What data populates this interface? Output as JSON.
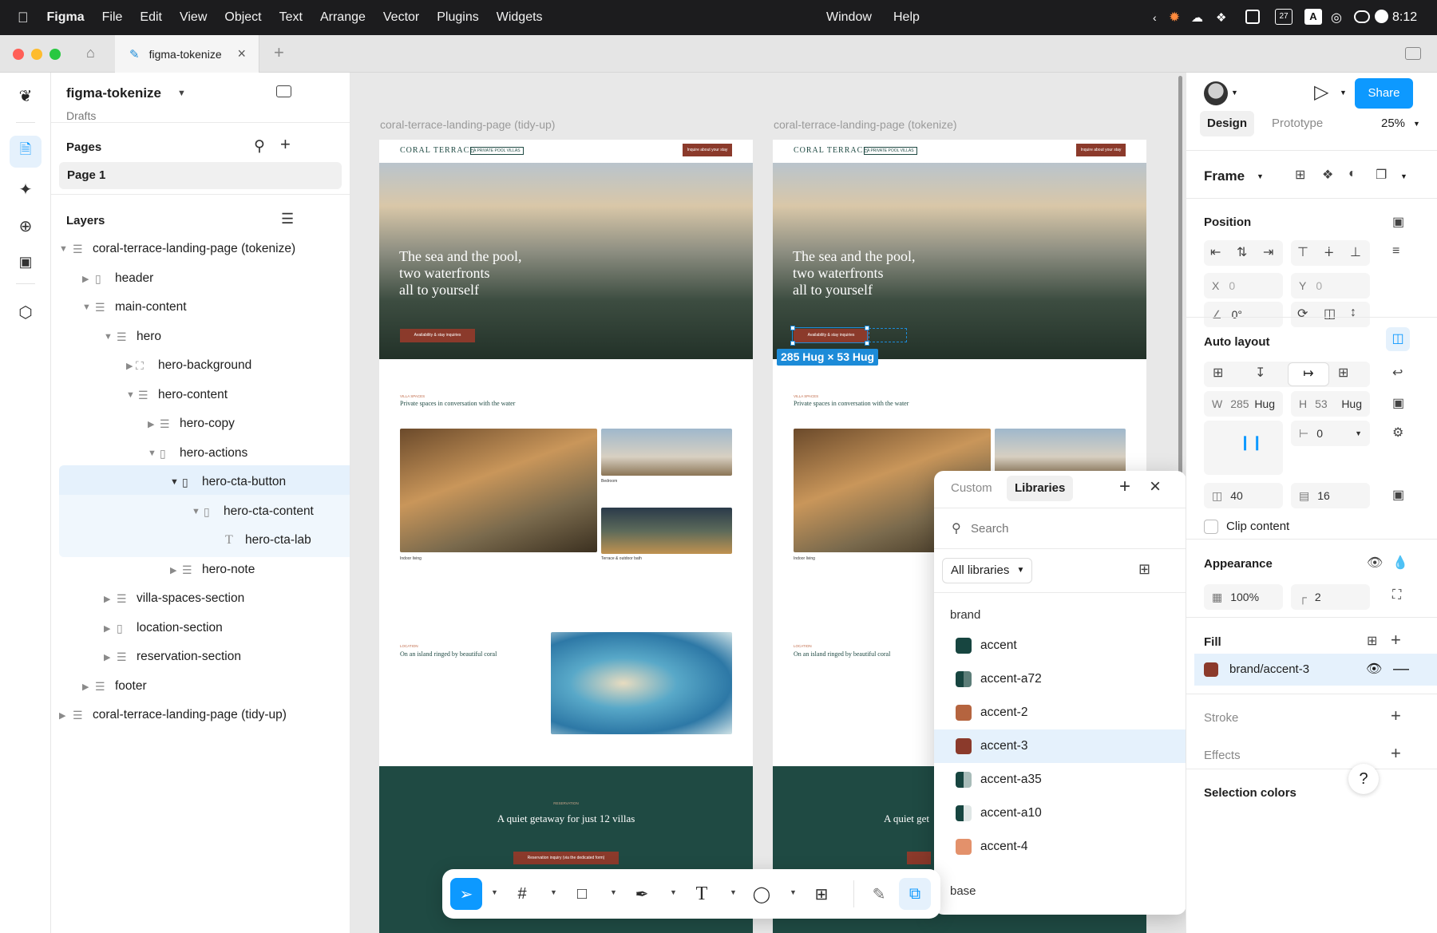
{
  "menubar": {
    "app": "Figma",
    "items": [
      "File",
      "Edit",
      "View",
      "Object",
      "Text",
      "Arrange",
      "Vector",
      "Plugins",
      "Widgets"
    ],
    "right_items": [
      "Window",
      "Help"
    ],
    "time": "8:12",
    "calendar_day": "27"
  },
  "tabs": {
    "active_label": "figma-tokenize",
    "add_label": "+"
  },
  "file": {
    "name": "figma-tokenize",
    "location": "Drafts"
  },
  "pages": {
    "heading": "Pages",
    "current": "Page 1"
  },
  "layers": {
    "heading": "Layers",
    "items": [
      {
        "label": "coral-terrace-landing-page (tokenize)"
      },
      {
        "label": "header"
      },
      {
        "label": "main-content"
      },
      {
        "label": "hero"
      },
      {
        "label": "hero-background"
      },
      {
        "label": "hero-content"
      },
      {
        "label": "hero-copy"
      },
      {
        "label": "hero-actions"
      },
      {
        "label": "hero-cta-button"
      },
      {
        "label": "hero-cta-content"
      },
      {
        "label": "hero-cta-lab"
      },
      {
        "label": "hero-note"
      },
      {
        "label": "villa-spaces-section"
      },
      {
        "label": "location-section"
      },
      {
        "label": "reservation-section"
      },
      {
        "label": "footer"
      },
      {
        "label": "coral-terrace-landing-page (tidy-up)"
      }
    ]
  },
  "canvas": {
    "frame_left_title": "coral-terrace-landing-page (tidy-up)",
    "frame_right_title": "coral-terrace-landing-page (tokenize)",
    "selection_label": "285 Hug × 53 Hug",
    "page": {
      "brand": "CORAL TERRACE",
      "brand_tag": "A PRIVATE POOL VILLAS",
      "nav_cta": "Inquire about your stay",
      "hero_line1": "The sea and the pool,",
      "hero_line2": "two waterfronts",
      "hero_line3": "all to yourself",
      "hero_cta": "Availability & stay inquiries",
      "villa_kicker": "VILLA SPACES",
      "villa_heading": "Private spaces in conversation with the water",
      "caption_indoor": "Indoor living",
      "caption_bedroom": "Bedroom",
      "caption_terrace": "Terrace & outdoor bath",
      "location_kicker": "LOCATION",
      "location_heading": "On an island ringed by beautiful coral",
      "reservation_kicker": "RESERVATION",
      "reservation_heading": "A quiet getaway for just 12 villas",
      "reservation_heading_cut": "A quiet get",
      "reservation_cta": "Reservation inquiry (via the dedicated form)"
    }
  },
  "right_panel": {
    "tab_design": "Design",
    "tab_prototype": "Prototype",
    "zoom": "25%",
    "share": "Share",
    "frame_label": "Frame",
    "position": {
      "title": "Position",
      "x_label": "X",
      "x": "0",
      "y_label": "Y",
      "y": "0",
      "rotation": "0°"
    },
    "auto_layout": {
      "title": "Auto layout",
      "w_label": "W",
      "w": "285",
      "w_mode": "Hug",
      "h_label": "H",
      "h": "53",
      "h_mode": "Hug",
      "gap": "0",
      "pad_h": "40",
      "pad_v": "16",
      "clip": "Clip content"
    },
    "appearance": {
      "title": "Appearance",
      "opacity": "100%",
      "radius": "2"
    },
    "fill": {
      "title": "Fill",
      "value": "brand/accent-3",
      "color": "#8b3a2b"
    },
    "stroke": {
      "title": "Stroke"
    },
    "effects": {
      "title": "Effects"
    },
    "selection_colors": {
      "title": "Selection colors"
    },
    "help": "?"
  },
  "library_popup": {
    "tab_custom": "Custom",
    "tab_libraries": "Libraries",
    "search_placeholder": "Search",
    "filter": "All libraries",
    "group_brand": "brand",
    "group_base": "base",
    "items": [
      {
        "label": "accent",
        "color": "#174540"
      },
      {
        "label": "accent-a72",
        "color": "#174540"
      },
      {
        "label": "accent-2",
        "color": "#b5643f"
      },
      {
        "label": "accent-3",
        "color": "#8b3a2b"
      },
      {
        "label": "accent-a35",
        "color": "#174540"
      },
      {
        "label": "accent-a10",
        "color": "#174540"
      },
      {
        "label": "accent-4",
        "color": "#e3916b"
      }
    ]
  },
  "colors": {
    "figma_blue": "#0d99ff",
    "selection_blue": "#1c8bd8",
    "hover_bg": "#e5f1fc",
    "accent_teal": "#1f4a43",
    "accent_rust": "#8b3a2b"
  }
}
